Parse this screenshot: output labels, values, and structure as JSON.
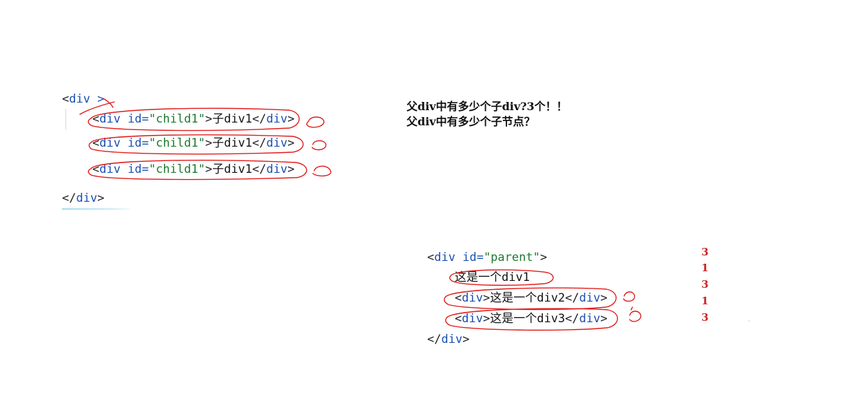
{
  "left_code": {
    "open_tag": "div >",
    "children": [
      {
        "tag": "div",
        "attr": "id=",
        "value": "\"child1\"",
        "text": "子div1"
      },
      {
        "tag": "div",
        "attr": "id=",
        "value": "\"child1\"",
        "text": "子div1"
      },
      {
        "tag": "div",
        "attr": "id=",
        "value": "\"child1\"",
        "text": "子div1"
      }
    ],
    "close_tag": "div"
  },
  "questions": {
    "line1": "父div中有多少个子div?3个！！",
    "line2": "父div中有多少个子节点？"
  },
  "right_code": {
    "open_tag": "div",
    "open_attr": "id=",
    "open_value": "\"parent\"",
    "text_node": "这是一个div1",
    "children": [
      {
        "tag": "div",
        "text": "这是一个div2"
      },
      {
        "tag": "div",
        "text": "这是一个div3"
      }
    ],
    "close_tag": "div"
  },
  "node_type_counts": [
    "3",
    "1",
    "3",
    "1",
    "3"
  ],
  "colors": {
    "annotation": "#e01b1b",
    "tag": "#1a4fb0",
    "string": "#1b7a2e"
  }
}
